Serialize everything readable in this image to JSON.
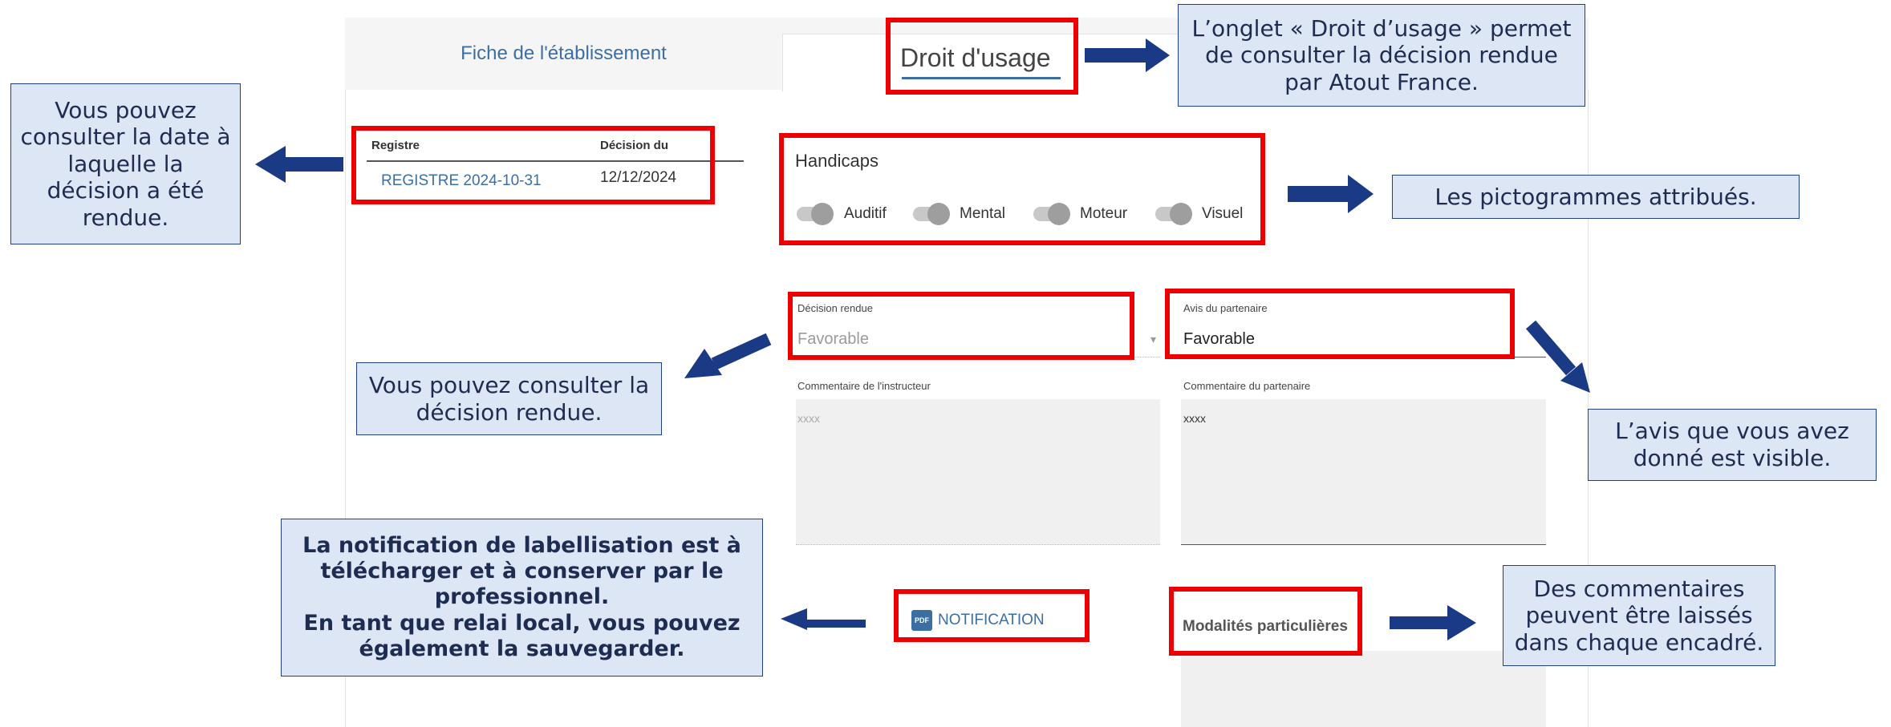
{
  "tabs": {
    "fiche": "Fiche de l'établissement",
    "droit_usage": "Droit d'usage"
  },
  "registry": {
    "col_registre": "Registre",
    "col_decision": "Décision du",
    "registre_link": "REGISTRE 2024-10-31",
    "decision_date": "12/12/2024"
  },
  "handicaps": {
    "title": "Handicaps",
    "items": [
      "Auditif",
      "Mental",
      "Moteur",
      "Visuel"
    ]
  },
  "form": {
    "decision_label": "Décision rendue",
    "decision_value": "Favorable",
    "avis_label": "Avis du partenaire",
    "avis_value": "Favorable",
    "comment_instr_label": "Commentaire de l'instructeur",
    "comment_instr_value": "xxxx",
    "comment_part_label": "Commentaire du partenaire",
    "comment_part_value": "xxxx",
    "notification_button": "NOTIFICATION",
    "pdf_badge": "PDF",
    "modalites_label": "Modalités particulières"
  },
  "notes": {
    "onglet": "L’onglet « Droit d’usage » permet de consulter la décision rendue par Atout France.",
    "date": "Vous pouvez consulter la date à laquelle la décision a été rendue.",
    "pictos": "Les pictogrammes attribués.",
    "decision": "Vous pouvez consulter la décision rendue.",
    "avis": "L’avis que vous avez donné est visible.",
    "notification_line1": "La notification de labellisation est à télécharger et à conserver par le professionnel.",
    "notification_line2": "En tant que relai local, vous pouvez également la sauvegarder.",
    "commentaires": "Des commentaires peuvent être laissés dans chaque encadré."
  },
  "colors": {
    "annotation_red": "#ee0000",
    "note_fill": "#dce6f4",
    "note_border": "#1f3f86",
    "arrow": "#1a3a86",
    "link_blue": "#3b6fa3"
  }
}
